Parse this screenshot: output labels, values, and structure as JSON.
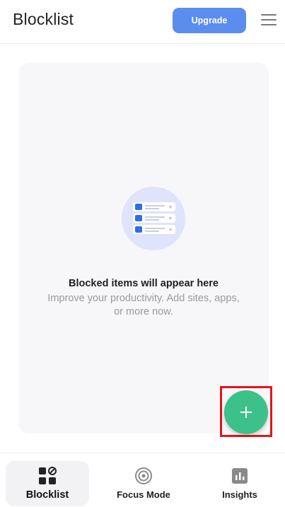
{
  "header": {
    "title": "Blocklist",
    "upgrade_label": "Upgrade",
    "menu_icon": "hamburger-menu-icon"
  },
  "empty_state": {
    "illustration": "blocked-list-illustration",
    "title": "Blocked items will appear here",
    "subtitle": "Improve your productivity. Add sites, apps, or more now."
  },
  "fab": {
    "icon": "plus-icon"
  },
  "bottom_nav": {
    "items": [
      {
        "label": "Blocklist",
        "icon": "blocklist-icon",
        "active": true
      },
      {
        "label": "Focus Mode",
        "icon": "target-icon",
        "active": false
      },
      {
        "label": "Insights",
        "icon": "bar-chart-icon",
        "active": false
      }
    ]
  },
  "colors": {
    "accent": "#5b8def",
    "fab": "#3cc18a",
    "highlight_frame": "#e5141b",
    "card_bg": "#f7f7f9"
  }
}
